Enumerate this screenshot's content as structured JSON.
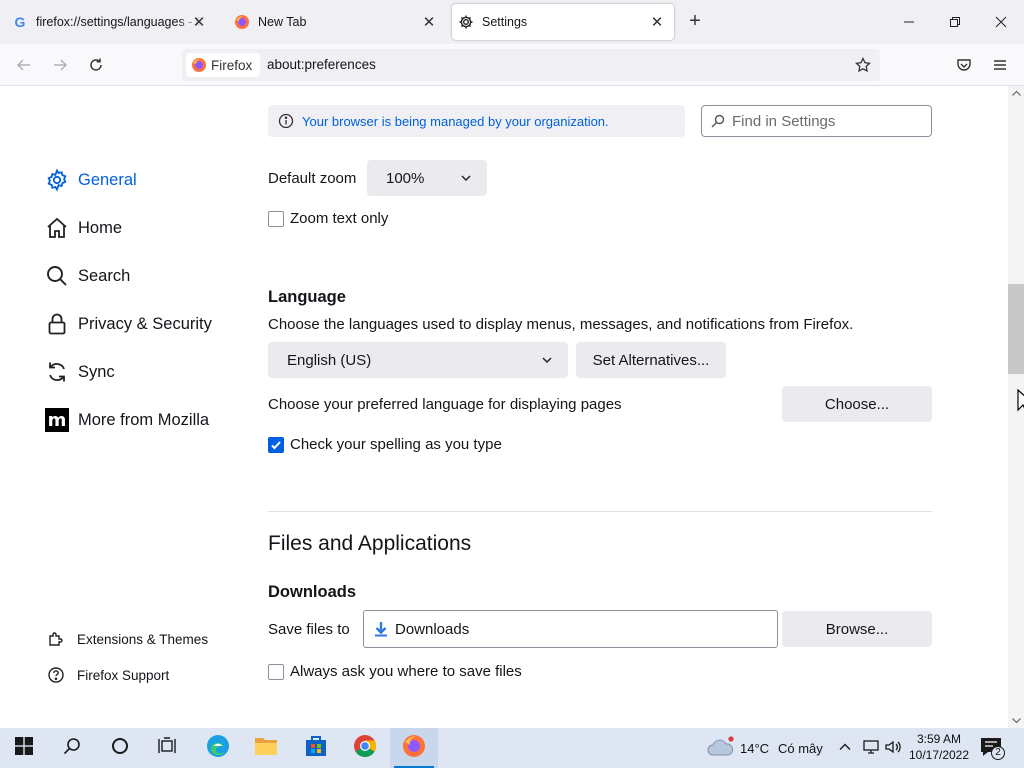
{
  "tabs": [
    {
      "title": "firefox://settings/languages - Google Search",
      "favicon": "google-g-icon",
      "active": false
    },
    {
      "title": "New Tab",
      "favicon": "firefox-icon",
      "active": false
    },
    {
      "title": "Settings",
      "favicon": "gear-icon",
      "active": true
    }
  ],
  "google_favicon_letter": "G",
  "newtab_symbol": "+",
  "close_symbol": "✕",
  "navbar": {
    "identity_label": "Firefox",
    "url": "about:preferences"
  },
  "sidebar": {
    "categories": [
      {
        "label": "General",
        "icon": "gear-icon",
        "selected": true
      },
      {
        "label": "Home",
        "icon": "home-icon",
        "selected": false
      },
      {
        "label": "Search",
        "icon": "search-icon",
        "selected": false
      },
      {
        "label": "Privacy & Security",
        "icon": "lock-icon",
        "selected": false
      },
      {
        "label": "Sync",
        "icon": "sync-icon",
        "selected": false
      },
      {
        "label": "More from Mozilla",
        "icon": "mozilla-icon",
        "selected": false
      }
    ],
    "footer_links": [
      {
        "label": "Extensions & Themes",
        "icon": "puzzle-icon"
      },
      {
        "label": "Firefox Support",
        "icon": "help-icon"
      }
    ],
    "mozilla_letter": "m"
  },
  "main": {
    "policy_notice": "Your browser is being managed by your organization.",
    "search_placeholder": "Find in Settings",
    "zoom": {
      "label": "Default zoom",
      "value": "100%",
      "zoom_text_only_label": "Zoom text only",
      "zoom_text_only_checked": false
    },
    "language": {
      "heading": "Language",
      "description": "Choose the languages used to display menus, messages, and notifications from Firefox.",
      "selected_language": "English (US)",
      "set_alternatives_button": "Set Alternatives...",
      "preferred_pages_label": "Choose your preferred language for displaying pages",
      "choose_button": "Choose...",
      "spellcheck_label": "Check your spelling as you type",
      "spellcheck_checked": true
    },
    "files_apps": {
      "heading": "Files and Applications",
      "downloads_heading": "Downloads",
      "save_files_label": "Save files to",
      "save_folder": "Downloads",
      "browse_button": "Browse...",
      "always_ask_label": "Always ask you where to save files",
      "always_ask_checked": false
    }
  },
  "taskbar": {
    "items": [
      {
        "name": "start-button",
        "icon": "windows-logo-icon"
      },
      {
        "name": "search-button",
        "icon": "search-icon"
      },
      {
        "name": "cortana-button",
        "icon": "circle-icon"
      },
      {
        "name": "task-view-button",
        "icon": "task-view-icon"
      },
      {
        "name": "edge-button",
        "icon": "edge-icon"
      },
      {
        "name": "file-explorer-button",
        "icon": "folder-icon"
      },
      {
        "name": "store-button",
        "icon": "store-icon"
      },
      {
        "name": "chrome-button",
        "icon": "chrome-icon"
      },
      {
        "name": "firefox-button",
        "icon": "firefox-icon",
        "active": true
      }
    ],
    "weather": {
      "temperature": "14°C",
      "condition": "Có mây"
    },
    "clock": {
      "time": "3:59 AM",
      "date": "10/17/2022"
    },
    "notification_count": "2",
    "accent_color": "#0078d4"
  },
  "colors": {
    "accent": "#0061e0",
    "tabstrip": "#f0f0f4",
    "taskbar": "#dde6f2"
  }
}
